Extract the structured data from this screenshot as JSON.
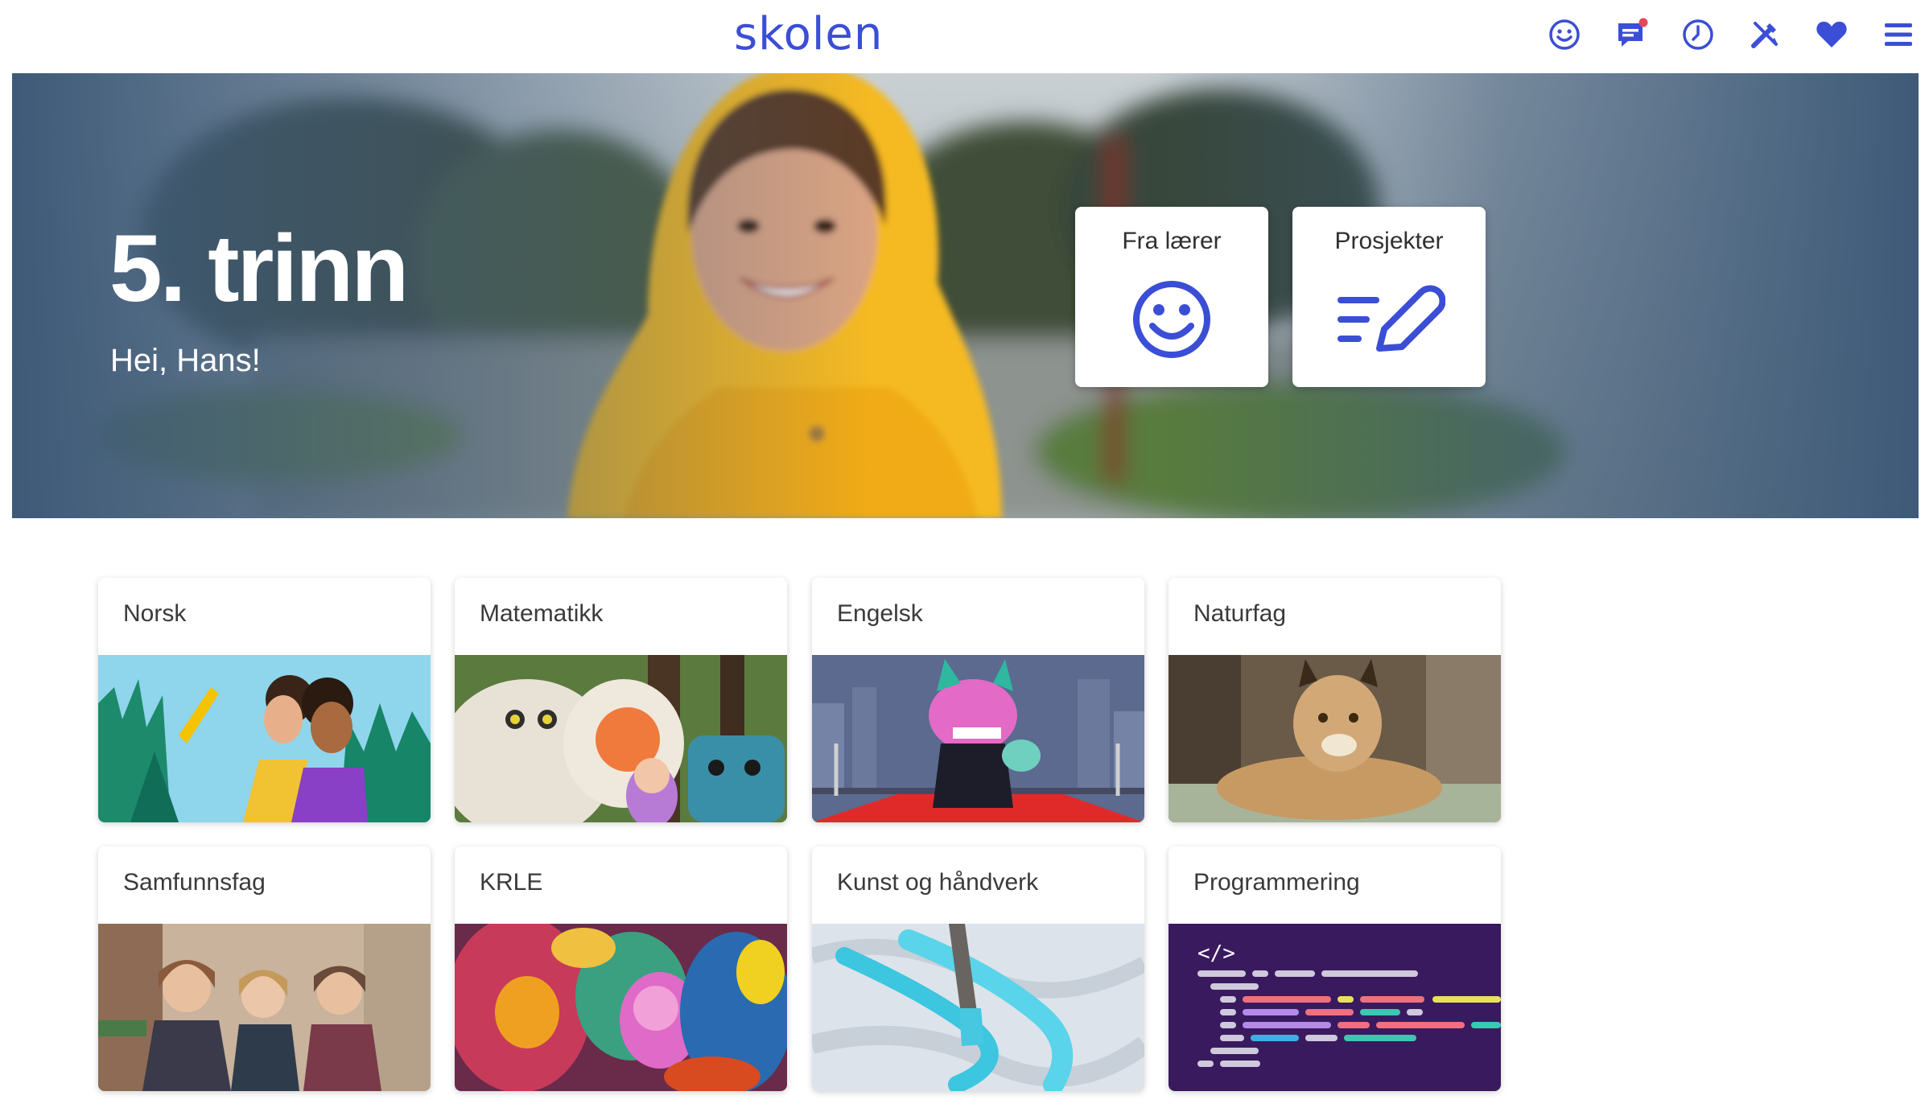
{
  "header": {
    "logo": "skolen",
    "accent_color": "#3b4ed6",
    "notification_dot_color": "#e8455a",
    "icons": [
      {
        "name": "smiley-icon"
      },
      {
        "name": "messages-icon"
      },
      {
        "name": "clock-icon"
      },
      {
        "name": "tools-icon"
      },
      {
        "name": "heart-icon"
      },
      {
        "name": "menu-icon"
      }
    ]
  },
  "hero": {
    "title": "5. trinn",
    "greeting": "Hei, Hans!",
    "cards": [
      {
        "label": "Fra lærer",
        "icon": "smiley-icon"
      },
      {
        "label": "Prosjekter",
        "icon": "pencil-list-icon"
      }
    ]
  },
  "subjects": [
    {
      "label": "Norsk"
    },
    {
      "label": "Matematikk"
    },
    {
      "label": "Engelsk"
    },
    {
      "label": "Naturfag"
    },
    {
      "label": "Samfunnsfag"
    },
    {
      "label": "KRLE"
    },
    {
      "label": "Kunst og håndverk"
    },
    {
      "label": "Programmering"
    }
  ]
}
